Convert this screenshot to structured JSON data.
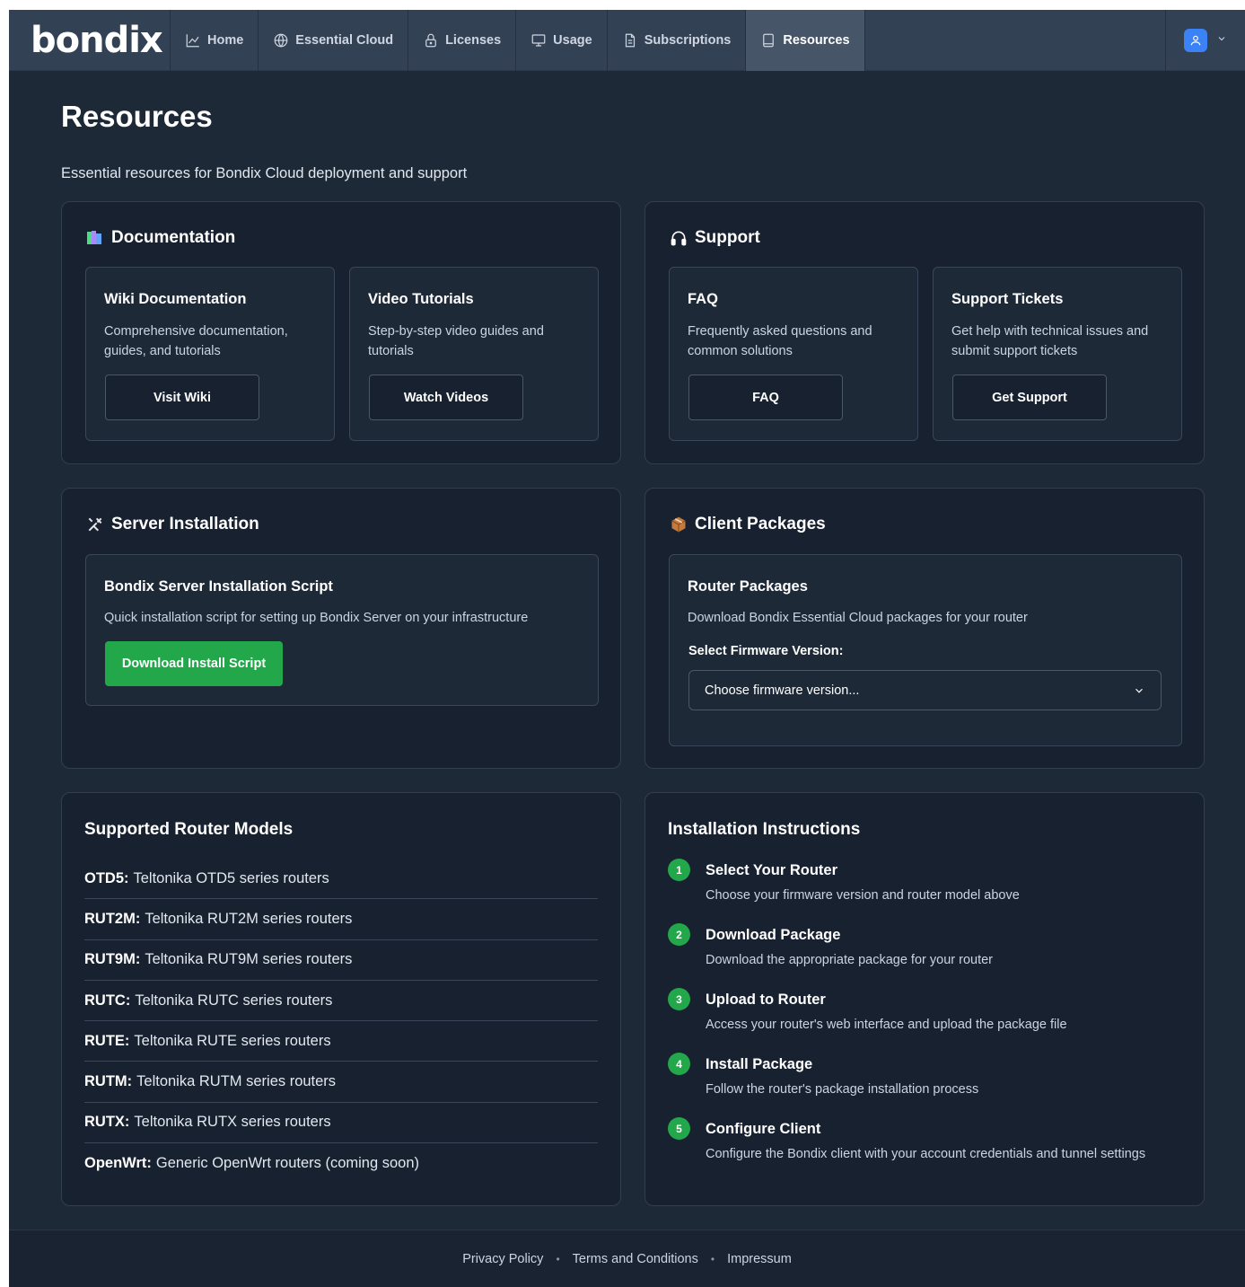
{
  "brand": {
    "logo_text": "bondix",
    "accent_green": "#22a74a",
    "accent_blue": "#3b82f6"
  },
  "nav": {
    "items": [
      {
        "label": "Home",
        "icon": "chart-line-icon"
      },
      {
        "label": "Essential Cloud",
        "icon": "globe-icon"
      },
      {
        "label": "Licenses",
        "icon": "lock-icon"
      },
      {
        "label": "Usage",
        "icon": "monitor-icon"
      },
      {
        "label": "Subscriptions",
        "icon": "document-icon"
      },
      {
        "label": "Resources",
        "icon": "book-icon",
        "active": true
      }
    ],
    "user_icon": "user-icon"
  },
  "page": {
    "title": "Resources",
    "subtitle": "Essential resources for Bondix Cloud deployment and support"
  },
  "documentation": {
    "title": "Documentation",
    "icon": "books-icon",
    "wiki": {
      "title": "Wiki Documentation",
      "desc_line1": "Comprehensive documentation,",
      "desc_line2": "guides, and tutorials",
      "button": "Visit Wiki"
    },
    "video": {
      "title": "Video Tutorials",
      "desc_line1": "Step-by-step video guides and",
      "desc_line2": "tutorials",
      "button": "Watch Videos"
    }
  },
  "support": {
    "title": "Support",
    "icon": "headphones-icon",
    "faq": {
      "title": "FAQ",
      "desc_line1": "Frequently asked questions and",
      "desc_line2": "common solutions",
      "button": "FAQ"
    },
    "tickets": {
      "title": "Support Tickets",
      "desc_line1": "Get help with technical issues and",
      "desc_line2": "submit support tickets",
      "button": "Get Support"
    }
  },
  "server": {
    "title": "Server Installation",
    "icon": "tools-icon",
    "script": {
      "title": "Bondix Server Installation Script",
      "desc": "Quick installation script for setting up Bondix Server on your infrastructure",
      "button": "Download Install Script"
    }
  },
  "client": {
    "title": "Client Packages",
    "icon": "package-icon",
    "router": {
      "title": "Router Packages",
      "desc": "Download Bondix Essential Cloud packages for your router",
      "select_label": "Select Firmware Version:",
      "select_value": "Choose firmware version..."
    }
  },
  "models": {
    "title": "Supported Router Models",
    "items": [
      {
        "code": "OTD5:",
        "desc": "Teltonika OTD5 series routers"
      },
      {
        "code": "RUT2M:",
        "desc": "Teltonika RUT2M series routers"
      },
      {
        "code": "RUT9M:",
        "desc": "Teltonika RUT9M series routers"
      },
      {
        "code": "RUTC:",
        "desc": "Teltonika RUTC series routers"
      },
      {
        "code": "RUTE:",
        "desc": "Teltonika RUTE series routers"
      },
      {
        "code": "RUTM:",
        "desc": "Teltonika RUTM series routers"
      },
      {
        "code": "RUTX:",
        "desc": "Teltonika RUTX series routers"
      },
      {
        "code": "OpenWrt:",
        "desc": "Generic OpenWrt routers (coming soon)"
      }
    ]
  },
  "instructions": {
    "title": "Installation Instructions",
    "steps": [
      {
        "num": "1",
        "title": "Select Your Router",
        "desc": "Choose your firmware version and router model above"
      },
      {
        "num": "2",
        "title": "Download Package",
        "desc": "Download the appropriate package for your router"
      },
      {
        "num": "3",
        "title": "Upload to Router",
        "desc": "Access your router's web interface and upload the package file"
      },
      {
        "num": "4",
        "title": "Install Package",
        "desc": "Follow the router's package installation process"
      },
      {
        "num": "5",
        "title": "Configure Client",
        "desc": "Configure the Bondix client with your account credentials and tunnel settings"
      }
    ]
  },
  "footer": {
    "privacy": "Privacy Policy",
    "terms": "Terms and Conditions",
    "impressum": "Impressum",
    "separator": "•"
  }
}
